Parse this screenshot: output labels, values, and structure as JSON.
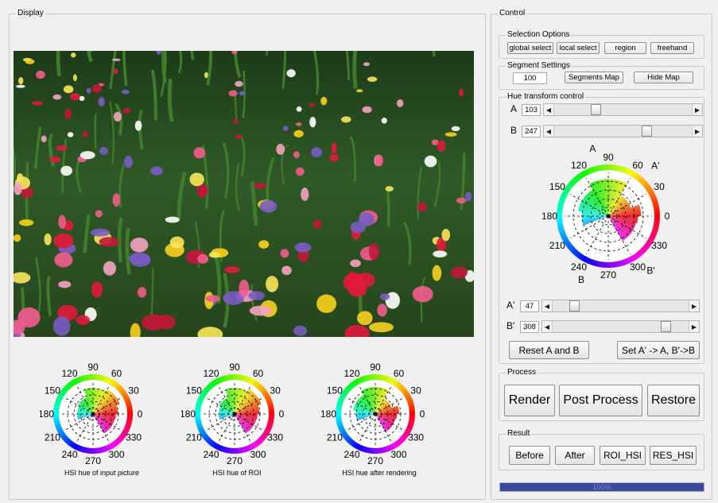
{
  "display": {
    "title": "Display",
    "captions": [
      "HSI hue of input picture",
      "HSI hue of ROI",
      "HSI hue after rendering"
    ]
  },
  "control": {
    "title": "Control",
    "selection": {
      "title": "Selection Options",
      "buttons": [
        "global select",
        "local select",
        "region",
        "freehand"
      ]
    },
    "segment": {
      "title": "Segment Settings",
      "value": "100",
      "map_button": "Segments Map",
      "hide_button": "Hide Map"
    },
    "hue": {
      "title": "Hue transform control",
      "a_label": "A",
      "a_value": "103",
      "b_label": "B",
      "b_value": "247",
      "a2_label": "A'",
      "a2_value": "47",
      "b2_label": "B'",
      "b2_value": "308",
      "slider_levels": {
        "A": 0.29,
        "B": 0.69,
        "A2": 0.13,
        "B2": 0.86
      },
      "reset_button": "Reset A and B",
      "set_button": "Set A' -> A, B'->B",
      "dial": {
        "angles": [
          "0",
          "30",
          "60",
          "90",
          "120",
          "150",
          "180",
          "210",
          "240",
          "270",
          "300",
          "330"
        ],
        "markers": {
          "A": "A",
          "A2": "A'",
          "B": "B",
          "B2": "B'"
        }
      }
    },
    "process": {
      "title": "Process",
      "buttons": [
        "Render",
        "Post Process",
        "Restore"
      ]
    },
    "result": {
      "title": "Result",
      "buttons": [
        "Before",
        "After",
        "ROI_HSI",
        "RES_HSI"
      ]
    },
    "progress": {
      "value": 1.0,
      "label": "100%"
    }
  },
  "colors": {
    "progress": "#3a4a9f",
    "red": "#e0203c",
    "green": "#4cc04c"
  }
}
